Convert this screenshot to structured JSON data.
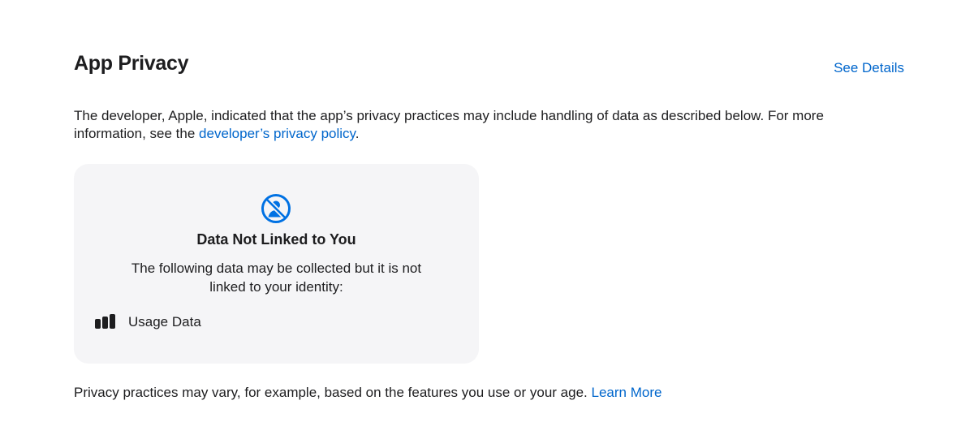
{
  "section": {
    "title": "App Privacy",
    "see_details": "See Details"
  },
  "intro": {
    "text": "The developer, Apple, indicated that the app’s privacy practices may include handling of data as described below. For more information, see the ",
    "link": "developer’s privacy policy",
    "trailing": "."
  },
  "card": {
    "icon": "person-crossed-icon",
    "title": "Data Not Linked to You",
    "description": "The following data may be collected but it is not linked to your identity:",
    "items": [
      {
        "icon": "usage-data-icon",
        "label": "Usage Data"
      }
    ]
  },
  "footer": {
    "text": "Privacy practices may vary, for example, based on the features you use or your age. ",
    "link": "Learn More"
  },
  "colors": {
    "link": "#0066cc",
    "text": "#1d1d1f",
    "card_bg": "#f5f5f7",
    "icon_accent": "#0071e3"
  }
}
